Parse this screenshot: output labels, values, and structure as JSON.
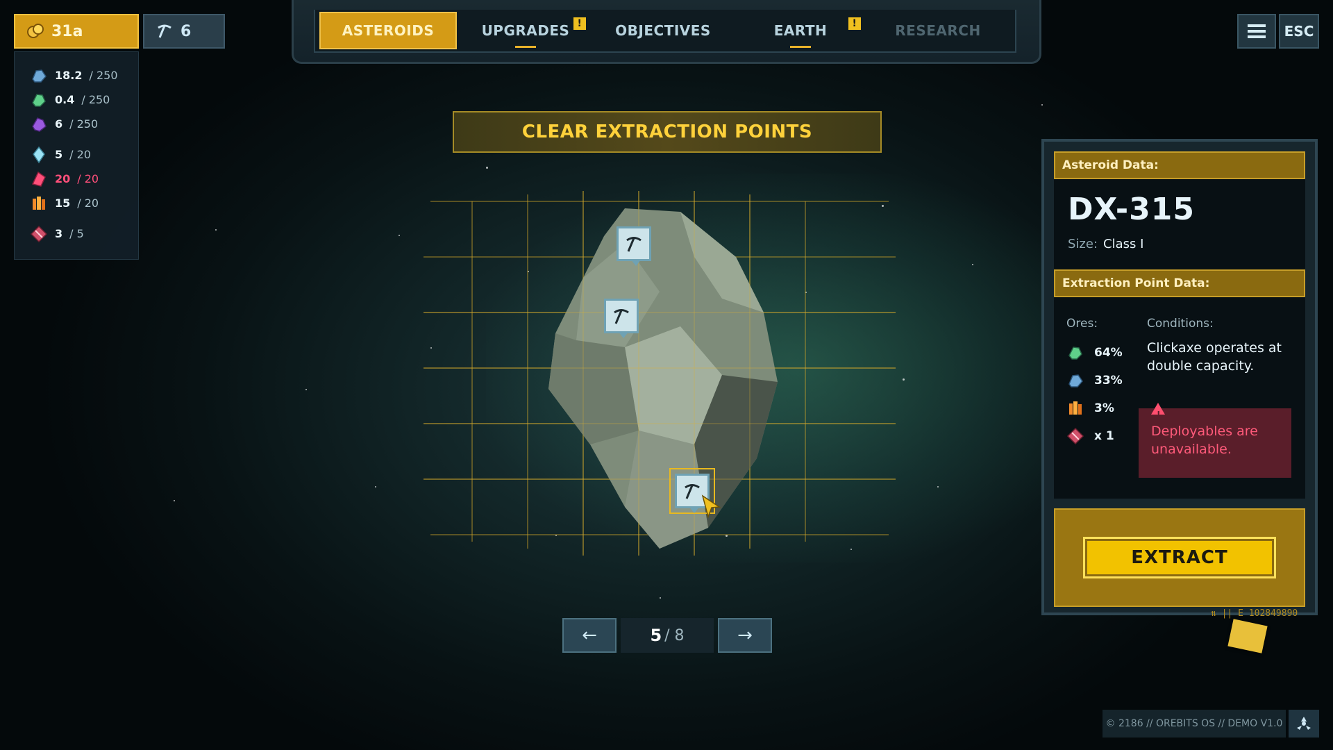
{
  "currency": {
    "credits": "31a",
    "picks": "6"
  },
  "resources": [
    {
      "icon": "blue-ore-icon",
      "value": "18.2",
      "max": "/ 250",
      "color": "#6fa9d8"
    },
    {
      "icon": "green-ore-icon",
      "value": "0.4",
      "max": "/ 250",
      "color": "#5fd08a"
    },
    {
      "icon": "purple-ore-icon",
      "value": "6",
      "max": "/ 250",
      "color": "#9a5ae0"
    },
    {
      "icon": "ice-crystal-icon",
      "value": "5",
      "max": "/ 20",
      "color": "#9be3f5"
    },
    {
      "icon": "pink-crystal-icon",
      "value": "20",
      "max": "/ 20",
      "color": "#ff4f7a"
    },
    {
      "icon": "orange-crystal-icon",
      "value": "15",
      "max": "/ 20",
      "color": "#f08a2a"
    },
    {
      "icon": "deployable-crate-icon",
      "value": "3",
      "max": "/ 5",
      "color": "#d0506a"
    }
  ],
  "tabs": [
    {
      "label": "ASTEROIDS",
      "state": "active"
    },
    {
      "label": "UPGRADES",
      "alert": "!"
    },
    {
      "label": "OBJECTIVES"
    },
    {
      "label": "EARTH",
      "alert": "!"
    },
    {
      "label": "RESEARCH",
      "state": "disabled"
    }
  ],
  "top_right": {
    "esc_label": "ESC"
  },
  "banner": {
    "text": "CLEAR EXTRACTION POINTS"
  },
  "pager": {
    "current": "5",
    "total": "/ 8"
  },
  "panel": {
    "asteroid_header": "Asteroid Data:",
    "asteroid_name": "DX-315",
    "size_label": "Size:",
    "size_value": "Class I",
    "extraction_header": "Extraction Point Data:",
    "ores_label": "Ores:",
    "conditions_label": "Conditions:",
    "ores": [
      {
        "icon": "green-ore-icon",
        "value": "64%"
      },
      {
        "icon": "blue-ore-icon",
        "value": "33%"
      },
      {
        "icon": "orange-crystal-icon",
        "value": "3%"
      },
      {
        "icon": "deployable-crate-icon",
        "value": "x 1"
      }
    ],
    "condition_text": "Clickaxe operates at double capacity.",
    "warning_text": "Deployables are unavailable.",
    "extract_label": "EXTRACT",
    "serial": "⇅ || E 102849890"
  },
  "footer": {
    "text": "© 2186  //  OREBITS OS  // DEMO V1.0"
  },
  "colors": {
    "accent_gold": "#d49b16",
    "panel_bg": "#17262d",
    "warning": "#ff5a7a"
  }
}
